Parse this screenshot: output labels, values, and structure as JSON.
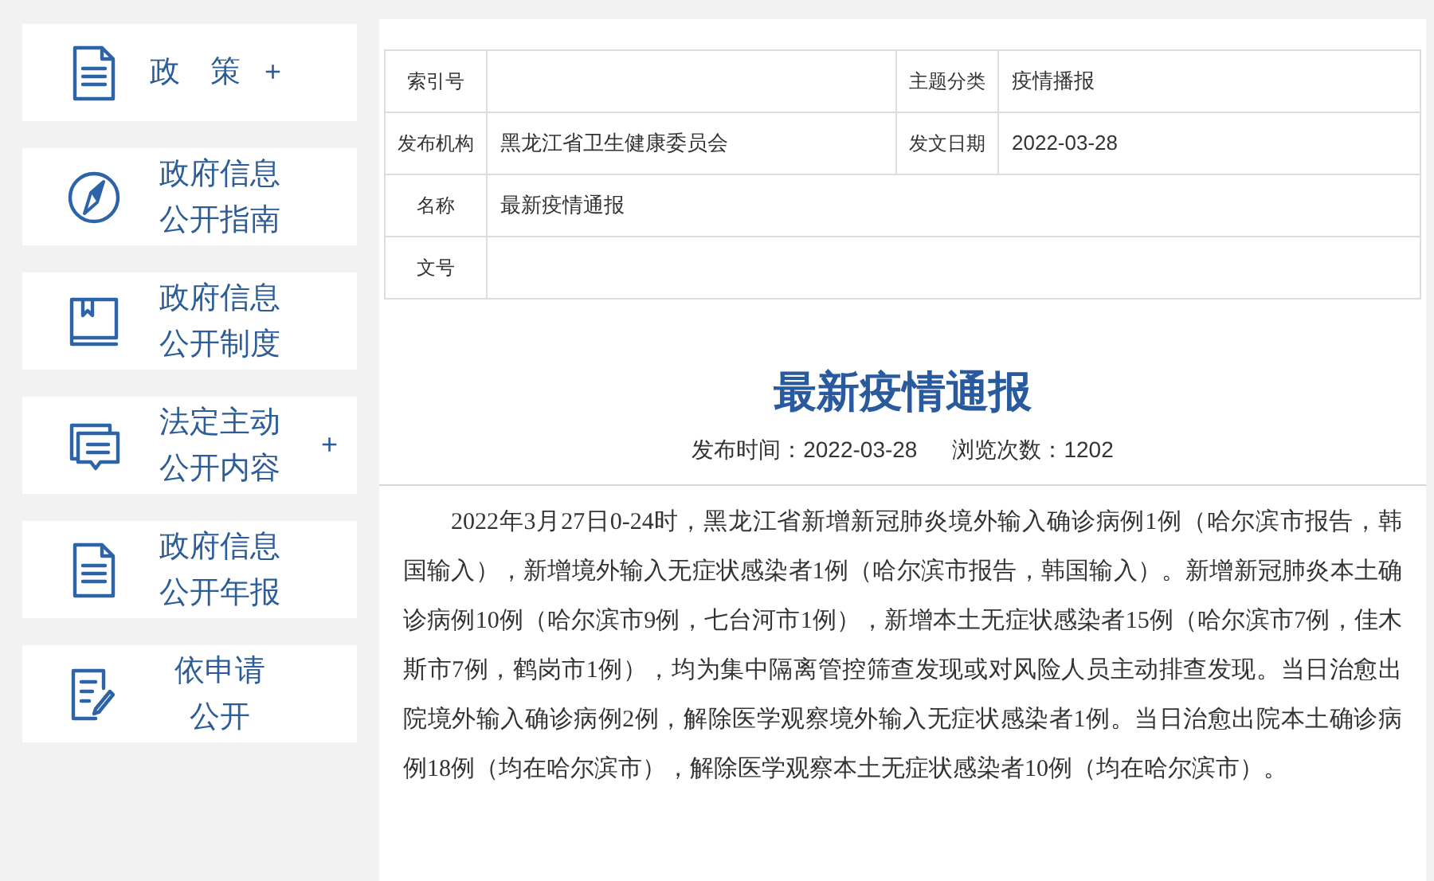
{
  "sidebar": {
    "items": [
      {
        "kind": "document",
        "lines": [
          "政策"
        ],
        "toggle": "+"
      },
      {
        "kind": "compass",
        "lines": [
          "政府信息",
          "公开指南"
        ]
      },
      {
        "kind": "book",
        "lines": [
          "政府信息",
          "公开制度"
        ]
      },
      {
        "kind": "chat",
        "lines": [
          "法定主动",
          "公开内容"
        ],
        "toggle": "+"
      },
      {
        "kind": "document",
        "lines": [
          "政府信息",
          "公开年报"
        ]
      },
      {
        "kind": "edit",
        "lines": [
          "依申请",
          "公开"
        ]
      }
    ]
  },
  "info_table": {
    "rows": [
      [
        {
          "label": "索引号"
        },
        {
          "label": "主题分类",
          "value": "疫情播报"
        }
      ],
      [
        {
          "label": "发布机构",
          "value": "黑龙江省卫生健康委员会"
        },
        {
          "label": "发文日期",
          "value": "2022-03-28"
        }
      ],
      [
        {
          "label": "名称",
          "value": "最新疫情通报"
        }
      ],
      [
        {
          "label": "文号"
        }
      ]
    ]
  },
  "article": {
    "title": "最新疫情通报",
    "published": "发布时间：2022-03-28",
    "views": "浏览次数：1202",
    "body": "2022年3月27日0-24时，黑龙江省新增新冠肺炎境外输入确诊病例1例（哈尔滨市报告，韩国输入），新增境外输入无症状感染者1例（哈尔滨市报告，韩国输入）。新增新冠肺炎本土确诊病例10例（哈尔滨市9例，七台河市1例），新增本土无症状感染者15例（哈尔滨市7例，佳木斯市7例，鹤岗市1例），均为集中隔离管控筛查发现或对风险人员主动排查发现。当日治愈出院境外输入确诊病例2例，解除医学观察境外输入无症状感染者1例。当日治愈出院本土确诊病例18例（均在哈尔滨市），解除医学观察本土无症状感染者10例（均在哈尔滨市）。"
  }
}
